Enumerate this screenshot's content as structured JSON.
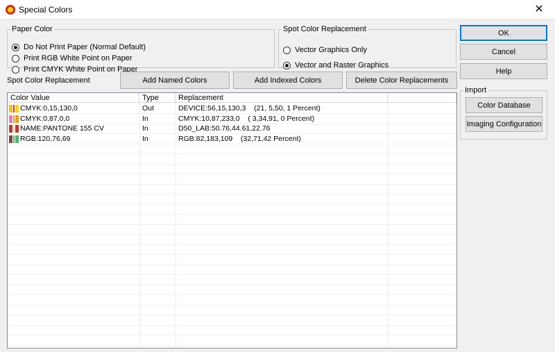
{
  "window": {
    "title": "Special Colors",
    "close_glyph": "✕"
  },
  "paper_color": {
    "legend": "Paper Color",
    "options": [
      {
        "label": "Do Not Print Paper  (Normal Default)",
        "selected": true
      },
      {
        "label": "Print RGB White Point on Paper",
        "selected": false
      },
      {
        "label": "Print CMYK White Point on Paper",
        "selected": false
      }
    ]
  },
  "spot_replacement_group": {
    "legend": "Spot Color Replacement",
    "options": [
      {
        "label": "Vector Graphics Only",
        "selected": false
      },
      {
        "label": "Vector and Raster Graphics",
        "selected": true
      }
    ]
  },
  "side_buttons": {
    "ok": "OK",
    "cancel": "Cancel",
    "help": "Help"
  },
  "import_group": {
    "legend": "Import",
    "color_database": "Color Database",
    "imaging_configuration": "Imaging Configuration"
  },
  "toolbar": {
    "label": "Spot Color Replacement",
    "add_named": "Add Named Colors",
    "add_indexed": "Add Indexed Colors",
    "delete_replacements": "Delete Color Replacements"
  },
  "table": {
    "columns": [
      "Color Value",
      "Type",
      "Replacement"
    ],
    "rows": [
      {
        "value": "CMYK:0,15,130,0",
        "type": "Out",
        "replacement": "DEVICE:56,15,130,3    (21, 5,50, 1 Percent)",
        "sw1": "#f5c400",
        "sw2": "#c0392b",
        "sw3": "#ffd400"
      },
      {
        "value": "CMYK:0,87,0,0",
        "type": "In",
        "replacement": "CMYK:10,87,233,0    ( 3,34,91, 0 Percent)",
        "sw1": "#e87cb8",
        "sw2": "#e8a010",
        "sw3": "#e8a010"
      },
      {
        "value": "NAME:PANTONE 155 CV",
        "type": "In",
        "replacement": "D50_LAB:50.76,44.61,22.76",
        "sw1": "#c0392b",
        "sw2": "#f2d5a5",
        "sw3": "#c0392b"
      },
      {
        "value": "RGB:120,76,69",
        "type": "In",
        "replacement": "RGB:82,183,109    (32,71,42 Percent)",
        "sw1": "#784c45",
        "sw2": "#52b76d",
        "sw3": "#52b76d"
      }
    ]
  }
}
